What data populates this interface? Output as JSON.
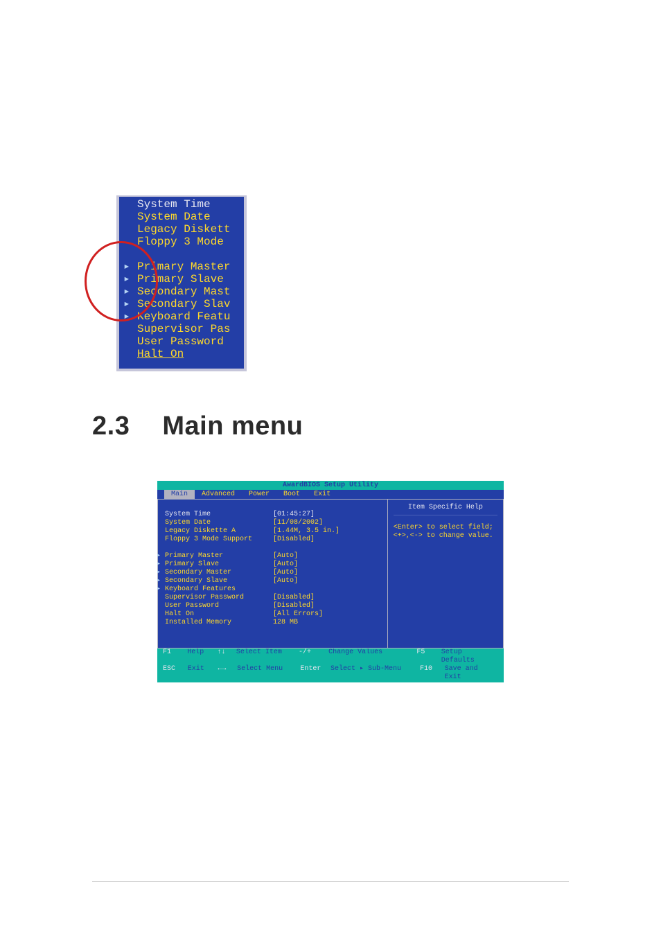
{
  "snippet": {
    "items": [
      {
        "label": "System Time",
        "pointer": false,
        "white": true
      },
      {
        "label": "System Date",
        "pointer": false,
        "white": false
      },
      {
        "label": "Legacy Diskett",
        "pointer": false,
        "white": false
      },
      {
        "label": "Floppy 3 Mode",
        "pointer": false,
        "white": false
      },
      {
        "label": "",
        "pointer": false,
        "white": false,
        "blank": true
      },
      {
        "label": "Primary Master",
        "pointer": true,
        "white": false
      },
      {
        "label": "Primary Slave",
        "pointer": true,
        "white": false
      },
      {
        "label": "Secondary Mast",
        "pointer": true,
        "white": false
      },
      {
        "label": "Secondary Slav",
        "pointer": true,
        "white": false
      },
      {
        "label": "Keyboard Featu",
        "pointer": true,
        "white": false
      },
      {
        "label": "Supervisor Pas",
        "pointer": false,
        "white": false
      },
      {
        "label": "User Password",
        "pointer": false,
        "white": false
      },
      {
        "label": "Halt On",
        "pointer": false,
        "white": false,
        "underline": true
      }
    ]
  },
  "heading": {
    "number": "2.3",
    "title": "Main menu"
  },
  "bios": {
    "title": "AwardBIOS Setup Utility",
    "tabs": [
      "Main",
      "Advanced",
      "Power",
      "Boot",
      "Exit"
    ],
    "selected_tab": "Main",
    "rows": [
      {
        "label": "System Time",
        "value": "[01:45:27]",
        "white": true,
        "pointer": false
      },
      {
        "label": "System Date",
        "value": "[11/08/2002]",
        "white": false,
        "pointer": false
      },
      {
        "label": "Legacy Diskette A",
        "value": "[1.44M, 3.5 in.]",
        "white": false,
        "pointer": false
      },
      {
        "label": "Floppy 3 Mode Support",
        "value": "[Disabled]",
        "white": false,
        "pointer": false
      },
      {
        "label": "",
        "value": "",
        "blank": true
      },
      {
        "label": "Primary Master",
        "value": "[Auto]",
        "white": false,
        "pointer": true
      },
      {
        "label": "Primary Slave",
        "value": "[Auto]",
        "white": false,
        "pointer": true
      },
      {
        "label": "Secondary Master",
        "value": "[Auto]",
        "white": false,
        "pointer": true
      },
      {
        "label": "Secondary Slave",
        "value": "[Auto]",
        "white": false,
        "pointer": true
      },
      {
        "label": "Keyboard Features",
        "value": "",
        "white": false,
        "pointer": true
      },
      {
        "label": "Supervisor Password",
        "value": "[Disabled]",
        "white": false,
        "pointer": false
      },
      {
        "label": "User Password",
        "value": "[Disabled]",
        "white": false,
        "pointer": false
      },
      {
        "label": "Halt On",
        "value": "[All Errors]",
        "white": false,
        "pointer": false
      },
      {
        "label": "Installed Memory",
        "value": "128 MB",
        "white": false,
        "pointer": false
      }
    ],
    "help": {
      "title": "Item Specific Help",
      "line1": "<Enter> to select field;",
      "line2": "<+>,<-> to change value."
    },
    "footer": {
      "r1": {
        "k1": "F1",
        "c1": "Help",
        "k2": "↑↓",
        "c2": "Select Item",
        "k3": "-/+",
        "c3": "Change Values",
        "k4": "F5",
        "c4": "Setup Defaults"
      },
      "r2": {
        "k1": "ESC",
        "c1": "Exit",
        "k2": "←→",
        "c2": "Select Menu",
        "k3": "Enter",
        "c3": "Select ▸ Sub-Menu",
        "k4": "F10",
        "c4": "Save and Exit"
      }
    }
  }
}
